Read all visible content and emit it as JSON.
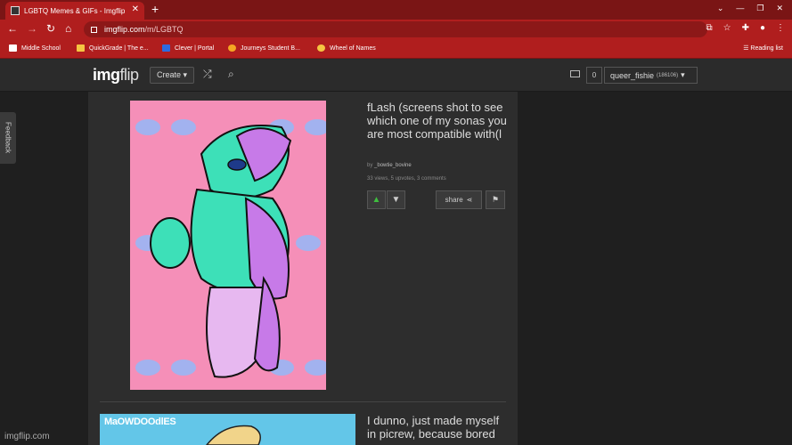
{
  "browser": {
    "tab_title": "LGBTQ Memes & GIFs - Imgflip",
    "url_host": "imgflip.com",
    "url_path": "/m/LGBTQ",
    "bookmarks": [
      {
        "label": "Middle School",
        "color": "#f5c542"
      },
      {
        "label": "QuickGrade | The e...",
        "color": "#f5c542"
      },
      {
        "label": "Clever | Portal",
        "color": "#2d6be0"
      },
      {
        "label": "Journeys Student B...",
        "color": "#f5a623"
      },
      {
        "label": "Wheel of Names",
        "color": "#f5c542"
      }
    ],
    "reading_list": "Reading list"
  },
  "site": {
    "logo_a": "img",
    "logo_b": "flip",
    "create_label": "Create ▾",
    "notif_count": "0",
    "username": "queer_fishie",
    "user_points": "(186106)",
    "feedback": "Feedback"
  },
  "posts": [
    {
      "title": "fLash (screens shot to see which one of my sonas you are most compatible with(l",
      "by_prefix": "by ",
      "author": "_bowtie_bovine",
      "stats": "33 views, 5 upvotes, 3 comments",
      "share_label": "share"
    },
    {
      "title": "I dunno, just made myself in picrew, because bored",
      "image_caption": "MaOWDOOdlES"
    }
  ],
  "watermark": "imgflip.com",
  "colors": {
    "chrome_red": "#b01e1e",
    "upvote_green": "#3fbf3f",
    "page_bg": "#1f1f1f",
    "panel_bg": "#2d2d2d"
  }
}
